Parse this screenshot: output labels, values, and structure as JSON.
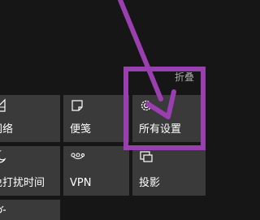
{
  "action_center": {
    "collapse_label": "折叠",
    "tiles": {
      "network": {
        "label": "网络",
        "icon": "network-icon"
      },
      "note": {
        "label": "便笺",
        "icon": "note-icon"
      },
      "settings": {
        "label": "所有设置",
        "icon": "gear-icon"
      },
      "quiet_hours": {
        "label": "免打扰时间",
        "icon": "moon-icon"
      },
      "vpn": {
        "label": "VPN",
        "icon": "vpn-icon"
      },
      "project": {
        "label": "投影",
        "icon": "project-icon"
      },
      "extra": {
        "icon": "brightness-icon"
      }
    }
  },
  "annotation": {
    "color": "#9b3fb0"
  }
}
